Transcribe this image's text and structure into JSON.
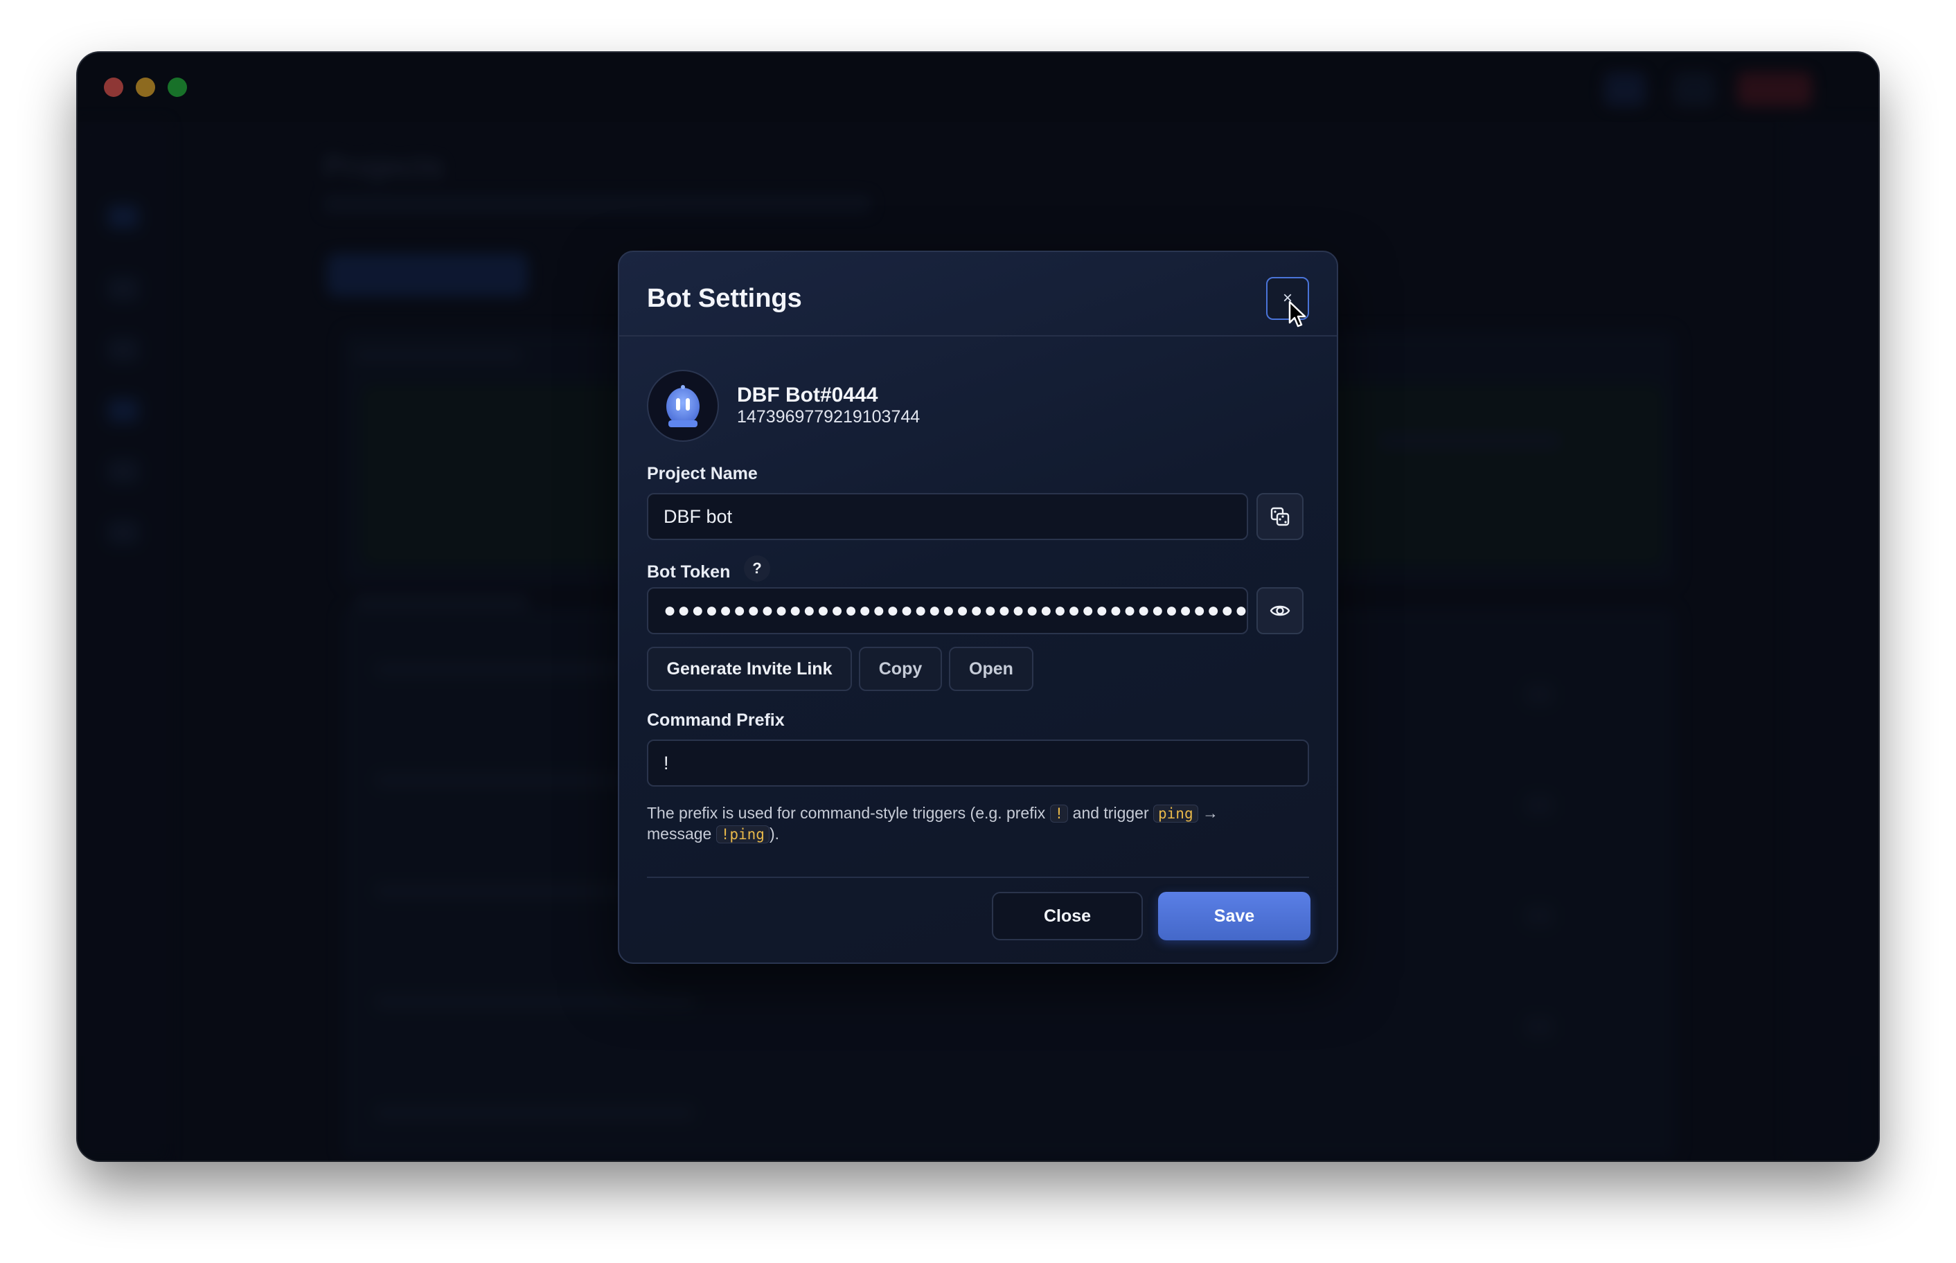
{
  "window": {
    "app_title": "Projects",
    "bg_window_label": "Projects · DBF bot"
  },
  "modal": {
    "title": "Bot Settings",
    "close_icon_glyph": "×",
    "bot": {
      "name": "DBF Bot#0444",
      "id": "1473969779219103744",
      "avatar_icon": "robot-icon",
      "avatar_color": "#5f86ee"
    },
    "project_name": {
      "label": "Project Name",
      "value": "DBF bot",
      "randomize_icon": "dice-icon"
    },
    "bot_token": {
      "label": "Bot Token",
      "help": "?",
      "masked_value": "●●●●●●●●●●●●●●●●●●●●●●●●●●●●●●●●●●●●●●●●●●●●●●●●●●●●",
      "reveal_icon": "eye-icon"
    },
    "invite": {
      "generate_label": "Generate Invite Link",
      "copy_label": "Copy",
      "open_label": "Open"
    },
    "command_prefix": {
      "label": "Command Prefix",
      "value": "!"
    },
    "hint": {
      "part1": "The prefix is used for command-style triggers (e.g. prefix",
      "code1": "!",
      "part2": "and trigger",
      "code2": "ping",
      "arrow": "→",
      "part3": "message",
      "code3": "!ping",
      "part4": ")."
    },
    "footer": {
      "close_label": "Close",
      "save_label": "Save"
    }
  },
  "colors": {
    "accent": "#4a74d8",
    "save_button": "#5073d6",
    "code_text": "#e8b84a",
    "window_bg": "#0b0f1a"
  }
}
